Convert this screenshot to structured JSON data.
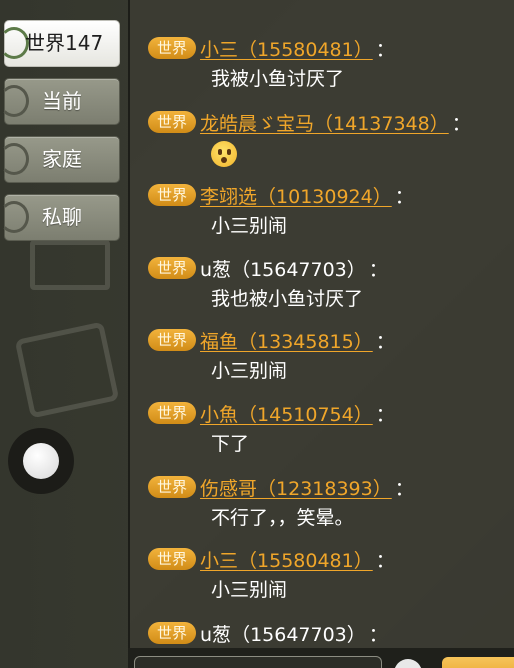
{
  "tabs": [
    {
      "label": "世界147",
      "active": true
    },
    {
      "label": "当前",
      "active": false
    },
    {
      "label": "家庭",
      "active": false
    },
    {
      "label": "私聊",
      "active": false
    }
  ],
  "channel_badge": "世界",
  "messages": [
    {
      "sender": "小三",
      "id": "（15580481）",
      "link": true,
      "colon": "：",
      "text": "我被小鱼讨厌了",
      "emoji": false
    },
    {
      "sender": "龙皓晨ゞ宝马",
      "id": "（14137348）",
      "link": true,
      "colon": "：",
      "text": "",
      "emoji": true
    },
    {
      "sender": "李翊选",
      "id": "（10130924）",
      "link": true,
      "colon": "：",
      "text": "小三别闹",
      "emoji": false
    },
    {
      "sender": "u葱",
      "id": "（15647703）",
      "link": false,
      "colon": "：",
      "text": "我也被小鱼讨厌了",
      "emoji": false
    },
    {
      "sender": "福鱼",
      "id": "（13345815）",
      "link": true,
      "colon": "：",
      "text": "小三别闹",
      "emoji": false
    },
    {
      "sender": "小魚",
      "id": "（14510754）",
      "link": true,
      "colon": "：",
      "text": "下了",
      "emoji": false
    },
    {
      "sender": "伤感哥",
      "id": "（12318393）",
      "link": true,
      "colon": "：",
      "text": "不行了，，笑晕。",
      "emoji": false
    },
    {
      "sender": "小三",
      "id": "（15580481）",
      "link": true,
      "colon": "：",
      "text": "小三别闹",
      "emoji": false
    },
    {
      "sender": "u葱",
      "id": "（15647703）",
      "link": false,
      "colon": "：",
      "text": "",
      "emoji": false
    }
  ],
  "colors": {
    "badge": "#e9a22a",
    "sender": "#f0a62a",
    "panel": "#3a3a32"
  }
}
